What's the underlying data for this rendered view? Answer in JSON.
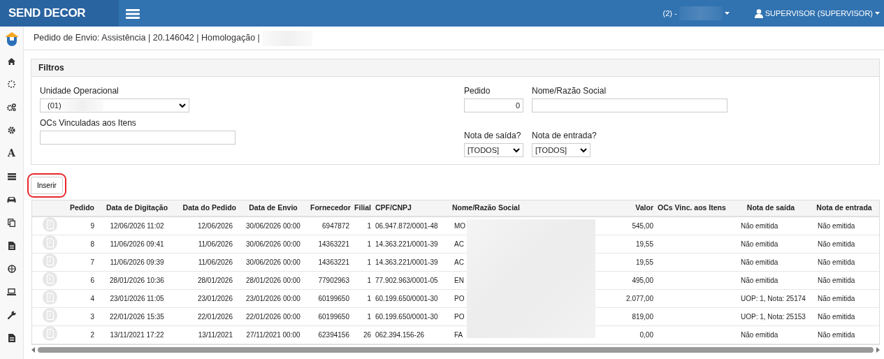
{
  "header": {
    "brand": "SEND DECOR",
    "company": "(2) -",
    "user": "SUPERVISOR (SUPERVISOR)"
  },
  "sidebar": {
    "items": [
      {
        "kind": "logo"
      },
      {
        "kind": "home"
      },
      {
        "kind": "spinner"
      },
      {
        "kind": "cogs"
      },
      {
        "kind": "cog"
      },
      {
        "kind": "glyph",
        "glyph": "A"
      },
      {
        "kind": "server"
      },
      {
        "kind": "car"
      },
      {
        "kind": "copy"
      },
      {
        "kind": "file"
      },
      {
        "kind": "globe"
      },
      {
        "kind": "laptop"
      },
      {
        "kind": "wrench"
      },
      {
        "kind": "file"
      }
    ]
  },
  "breadcrumb": "Pedido de Envio: Assistência | 20.146042 | Homologação |",
  "filters": {
    "title": "Filtros",
    "unidade": {
      "label": "Unidade Operacional",
      "value": "(01)"
    },
    "pedido": {
      "label": "Pedido",
      "value": "0"
    },
    "nome": {
      "label": "Nome/Razão Social"
    },
    "ocs": {
      "label": "OCs Vinculadas aos Itens"
    },
    "nota_saida": {
      "label": "Nota de saída?",
      "value": "[TODOS]"
    },
    "nota_entrada": {
      "label": "Nota de entrada?",
      "value": "[TODOS]"
    }
  },
  "insert_button": {
    "label": "Inserir",
    "circled": true
  },
  "table": {
    "columns": [
      "Pedido",
      "Data de Digitação",
      "Data do Pedido",
      "Data de Envio",
      "Fornecedor",
      "Filial",
      "CPF/CNPJ",
      "Nome/Razão Social",
      "Valor",
      "OCs Vinc. aos Itens",
      "Nota de saída",
      "Nota de entrada"
    ],
    "rows": [
      {
        "disabled": true,
        "cells": [
          "9",
          "12/06/2026 11:02",
          "12/06/2026",
          "30/06/2026 00:00",
          "6947872",
          "1",
          "06.947.872/0001-48",
          "MO",
          "545,00",
          "",
          "Não emitida",
          "Não emitida"
        ]
      },
      {
        "disabled": true,
        "cells": [
          "8",
          "11/06/2026 09:41",
          "11/06/2026",
          "30/06/2026 00:00",
          "14363221",
          "1",
          "14.363.221/0001-39",
          "AC",
          "19,55",
          "",
          "Não emitida",
          "Não emitida"
        ]
      },
      {
        "disabled": true,
        "cells": [
          "7",
          "11/06/2026 09:39",
          "11/06/2026",
          "30/06/2026 00:00",
          "14363221",
          "1",
          "14.363.221/0001-39",
          "AC",
          "19,55",
          "",
          "Não emitida",
          "Não emitida"
        ]
      },
      {
        "disabled": true,
        "cells": [
          "6",
          "28/01/2026 10:36",
          "28/01/2026",
          "28/01/2026 00:00",
          "77902963",
          "1",
          "77.902.963/0001-05",
          "EN",
          "495,00",
          "",
          "Não emitida",
          "Não emitida"
        ]
      },
      {
        "disabled": true,
        "cells": [
          "4",
          "23/01/2026 11:05",
          "23/01/2026",
          "23/01/2026 00:00",
          "60199650",
          "1",
          "60.199.650/0001-30",
          "PO",
          "2.077,00",
          "",
          "UOP: 1, Nota: 25174",
          "Não emitida"
        ]
      },
      {
        "disabled": true,
        "cells": [
          "3",
          "22/01/2026 15:35",
          "22/01/2026",
          "22/01/2026 00:00",
          "60199650",
          "1",
          "60.199.650/0001-30",
          "PO",
          "819,00",
          "",
          "UOP: 1, Nota: 25153",
          "Não emitida"
        ]
      },
      {
        "disabled": true,
        "cells": [
          "2",
          "13/11/2021 17:22",
          "13/11/2021",
          "27/11/2021 00:00",
          "62394156",
          "26",
          "062.394.156-26",
          "FA",
          "0,00",
          "",
          "Não emitida",
          "Não emitida"
        ]
      }
    ]
  }
}
